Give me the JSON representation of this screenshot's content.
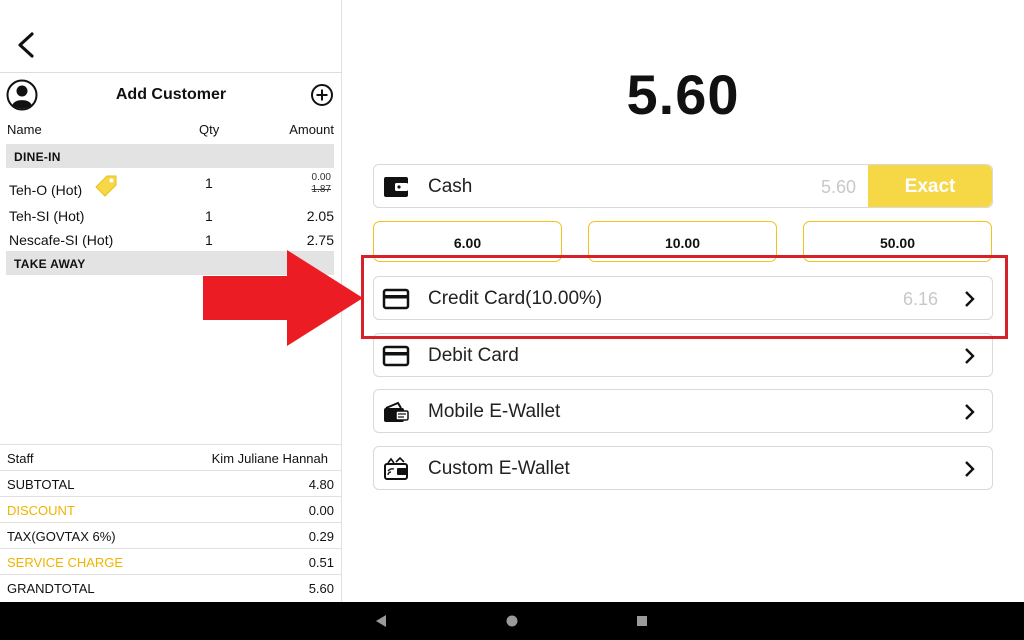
{
  "total": "5.60",
  "customer": {
    "label": "Add Customer"
  },
  "columns": {
    "name": "Name",
    "qty": "Qty",
    "amount": "Amount"
  },
  "sections": [
    "DINE-IN",
    "TAKE AWAY"
  ],
  "items": [
    {
      "name": "Teh-O (Hot)",
      "qty": "1",
      "amount": "0.00",
      "original_amount": "1.87"
    },
    {
      "name": "Teh-SI (Hot)",
      "qty": "1",
      "amount": "2.05"
    },
    {
      "name": "Nescafe-SI (Hot)",
      "qty": "1",
      "amount": "2.75"
    }
  ],
  "summary": {
    "staff_label": "Staff",
    "staff_value": "Kim Juliane Hannah",
    "subtotal_label": "SUBTOTAL",
    "subtotal_value": "4.80",
    "discount_label": "DISCOUNT",
    "discount_value": "0.00",
    "tax_label": "TAX(GOVTAX 6%)",
    "tax_value": "0.29",
    "service_label": "SERVICE CHARGE",
    "service_value": "0.51",
    "grand_label": "GRANDTOTAL",
    "grand_value": "5.60"
  },
  "payment": {
    "cash_label": "Cash",
    "cash_amount": "5.60",
    "exact_label": "Exact",
    "quick_amounts": [
      "6.00",
      "10.00",
      "50.00"
    ],
    "credit_label": "Credit Card(10.00%)",
    "credit_amount": "6.16",
    "debit_label": "Debit Card",
    "mobile_label": "Mobile E-Wallet",
    "custom_label": "Custom E-Wallet"
  },
  "colors": {
    "accent": "#f6d846",
    "highlight": "#d6202a",
    "warning_text": "#f0b400"
  }
}
